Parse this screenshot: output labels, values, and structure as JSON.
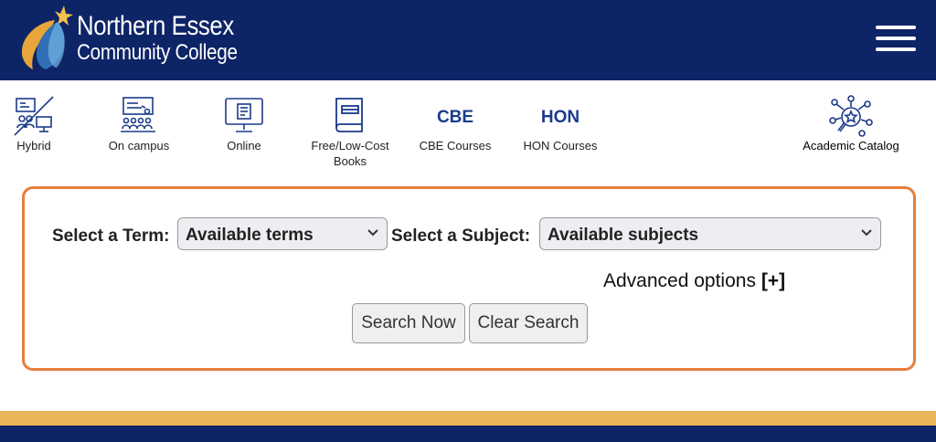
{
  "header": {
    "brand_line1": "Northern Essex",
    "brand_line2": "Community College",
    "logo_icon": "necc-star-logo-icon",
    "menu_icon": "hamburger-menu-icon"
  },
  "modes": [
    {
      "label": "Hybrid",
      "icon": "hybrid-classroom-icon"
    },
    {
      "label": "On campus",
      "icon": "lecture-classroom-icon"
    },
    {
      "label": "Online",
      "icon": "computer-monitor-icon"
    },
    {
      "label_line1": "Free/Low-Cost",
      "label_line2": "Books",
      "icon": "book-icon"
    },
    {
      "abbr": "CBE",
      "label": "CBE Courses"
    },
    {
      "abbr": "HON",
      "label": "HON Courses"
    },
    {
      "label": "Academic Catalog",
      "icon": "catalog-network-search-icon"
    }
  ],
  "search": {
    "term_label": "Select a Term:",
    "term_value": "Available terms",
    "subject_label": "Select a Subject:",
    "subject_value": "Available subjects",
    "advanced_text": "Advanced options",
    "advanced_toggle": "[+]",
    "search_button": "Search Now",
    "clear_button": "Clear Search"
  },
  "colors": {
    "header_navy": "#0d2466",
    "accent_orange": "#e77d3b",
    "footer_gold": "#e8b658",
    "icon_blue": "#1a3a8a"
  }
}
